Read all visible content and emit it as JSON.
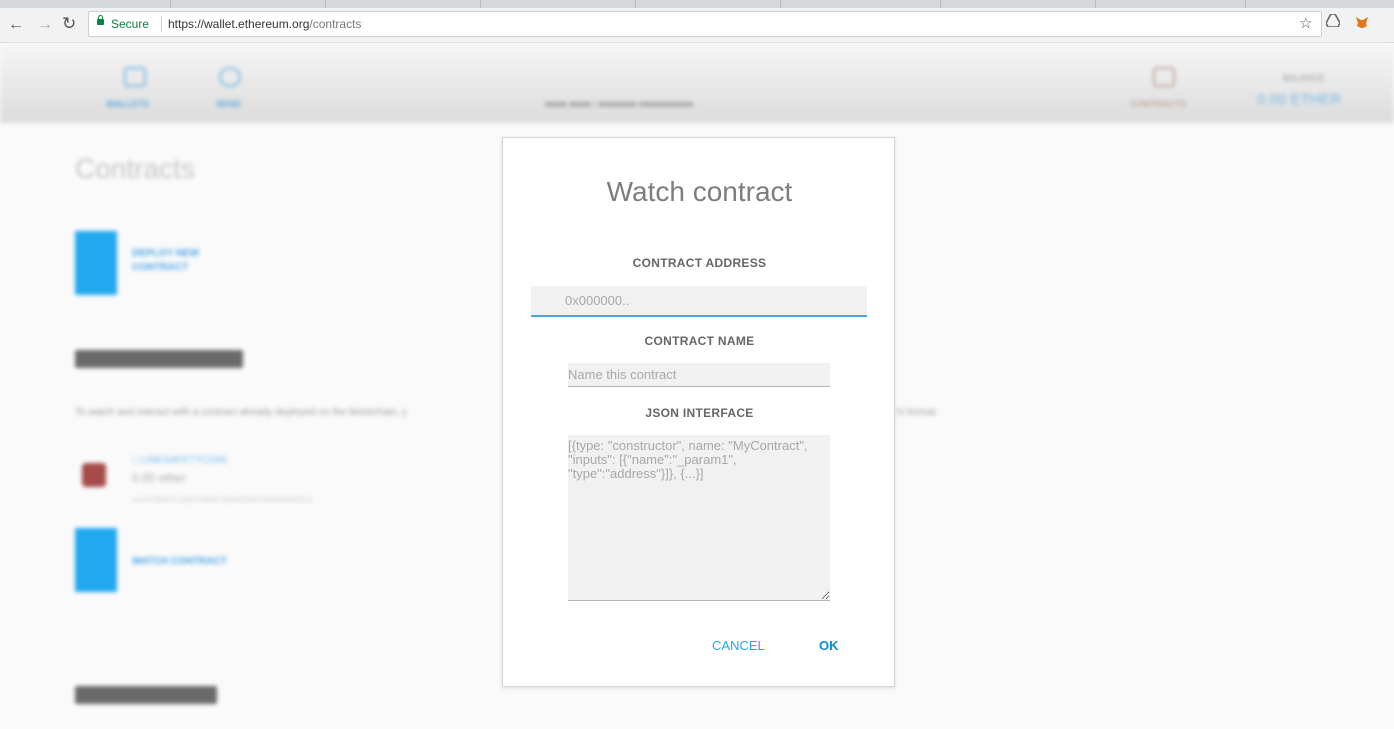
{
  "browser": {
    "back_icon": "back-arrow-icon",
    "forward_icon": "forward-arrow-icon",
    "reload_icon": "reload-icon",
    "secure_label": "Secure",
    "url_host": "https://wallet.ethereum.org",
    "url_path": "/contracts",
    "extensions": [
      "star-icon",
      "drive-icon",
      "metamask-fox-icon"
    ]
  },
  "modal": {
    "title": "Watch contract",
    "address_label": "CONTRACT ADDRESS",
    "address_placeholder": "0x000000..",
    "name_label": "CONTRACT NAME",
    "name_placeholder": "Name this contract",
    "json_label": "JSON INTERFACE",
    "json_placeholder": "[{type: \"constructor\", name: \"MyContract\", \"inputs\": [{\"name\":\"_param1\", \"type\":\"address\"}]}, {...}]",
    "cancel_label": "CANCEL",
    "ok_label": "OK"
  },
  "background_page": {
    "title": "Contracts"
  },
  "colors": {
    "accent": "#22a8ef",
    "ok_button": "#0a8cd6",
    "secure_green": "#0b8043"
  }
}
